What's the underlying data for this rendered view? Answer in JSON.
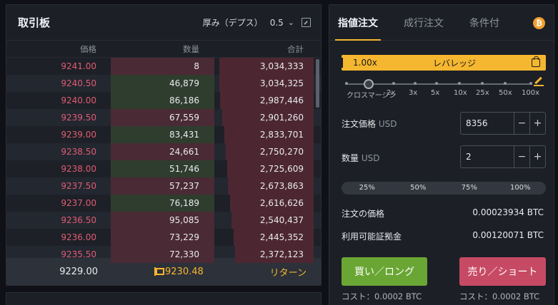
{
  "order_book": {
    "title": "取引板",
    "depth_label": "厚み（デプス）",
    "depth_value": "0.5",
    "columns": {
      "price": "価格",
      "quantity": "数量",
      "total": "合計"
    },
    "rows": [
      {
        "price": "9241.00",
        "quantity": "8",
        "total": "3,034,333",
        "qty_fill": 1.0,
        "qty_color": "#4a2a34",
        "total_fill": 1.0
      },
      {
        "price": "9240.50",
        "quantity": "46,879",
        "total": "3,034,325",
        "qty_fill": 1.0,
        "qty_color": "#2f3d2e",
        "total_fill": 1.0
      },
      {
        "price": "9240.00",
        "quantity": "86,186",
        "total": "2,987,446",
        "qty_fill": 1.0,
        "qty_color": "#2f3d2e",
        "total_fill": 0.99
      },
      {
        "price": "9239.50",
        "quantity": "67,559",
        "total": "2,901,260",
        "qty_fill": 1.0,
        "qty_color": "#4a2a34",
        "total_fill": 0.97
      },
      {
        "price": "9239.00",
        "quantity": "83,431",
        "total": "2,833,701",
        "qty_fill": 1.0,
        "qty_color": "#2f3d2e",
        "total_fill": 0.95
      },
      {
        "price": "9238.50",
        "quantity": "24,661",
        "total": "2,750,270",
        "qty_fill": 1.0,
        "qty_color": "#4a2a34",
        "total_fill": 0.93
      },
      {
        "price": "9238.00",
        "quantity": "51,746",
        "total": "2,725,609",
        "qty_fill": 1.0,
        "qty_color": "#2f3d2e",
        "total_fill": 0.92
      },
      {
        "price": "9237.50",
        "quantity": "57,237",
        "total": "2,673,863",
        "qty_fill": 1.0,
        "qty_color": "#4a2a34",
        "total_fill": 0.91
      },
      {
        "price": "9237.00",
        "quantity": "76,189",
        "total": "2,616,626",
        "qty_fill": 1.0,
        "qty_color": "#2f3d2e",
        "total_fill": 0.89
      },
      {
        "price": "9236.50",
        "quantity": "95,085",
        "total": "2,540,437",
        "qty_fill": 1.0,
        "qty_color": "#4a2a34",
        "total_fill": 0.87
      },
      {
        "price": "9236.00",
        "quantity": "73,229",
        "total": "2,445,352",
        "qty_fill": 1.0,
        "qty_color": "#4a2a34",
        "total_fill": 0.85
      },
      {
        "price": "9235.50",
        "quantity": "72,330",
        "total": "2,372,123",
        "qty_fill": 1.0,
        "qty_color": "#4a2a34",
        "total_fill": 0.83
      }
    ],
    "last_price": "9229.00",
    "mark_price": "9230.48",
    "return_label": "リターン"
  },
  "order_form": {
    "tabs": [
      "指値注文",
      "成行注文",
      "条件付"
    ],
    "active_tab": 0,
    "coin_icon": "bitcoin-icon",
    "leverage": {
      "value": "1.00x",
      "label": "レバレッジ"
    },
    "leverage_ticks": [
      "クロスマージン",
      "2x",
      "3x",
      "5x",
      "10x",
      "25x",
      "50x",
      "100x"
    ],
    "price_label": "注文価格",
    "price_unit": "USD",
    "price_value": "8356",
    "qty_label": "数量",
    "qty_unit": "USD",
    "qty_value": "2",
    "minus": "−",
    "plus": "+",
    "percent_options": [
      "25%",
      "50%",
      "75%",
      "100%"
    ],
    "order_value_label": "注文の価格",
    "order_value": "0.00023934 BTC",
    "available_margin_label": "利用可能証拠金",
    "available_margin": "0.00120071 BTC",
    "buy_label": "買い／ロング",
    "sell_label": "売り／ショート",
    "buy_cost": "コスト：0.0002 BTC",
    "sell_cost": "コスト：0.0002 BTC"
  }
}
